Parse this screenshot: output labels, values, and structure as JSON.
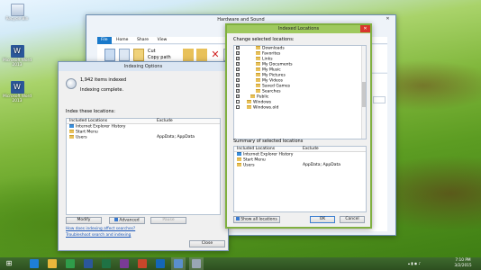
{
  "desktop_icons": [
    {
      "label": "Recycle Bin",
      "color": "#ccd8e8"
    },
    {
      "label": "Microsoft Word 2013",
      "color": "#2b579a"
    },
    {
      "label": "Microsoft Word 2013",
      "color": "#2b579a"
    }
  ],
  "hs_window": {
    "title": "Hardware and Sound",
    "ribbon": [
      "File",
      "Home",
      "Share",
      "View"
    ],
    "cut": "Cut",
    "copy_path": "Copy path"
  },
  "indexing": {
    "title": "Indexing Options",
    "items_indexed": "1,942 items indexed",
    "status": "Indexing complete.",
    "index_label": "Index these locations:",
    "col_included": "Included Locations",
    "col_exclude": "Exclude",
    "rows": [
      {
        "name": "Internet Explorer History",
        "exclude": ""
      },
      {
        "name": "Start Menu",
        "exclude": ""
      },
      {
        "name": "Users",
        "exclude": "AppData; AppData"
      }
    ],
    "modify": "Modify",
    "advanced": "Advanced",
    "pause": "Pause",
    "link1": "How does indexing affect searches?",
    "link2": "Troubleshoot search and indexing",
    "close": "Close"
  },
  "indexed": {
    "title": "Indexed Locations",
    "change_label": "Change selected locations:",
    "tree": [
      {
        "label": "Downloads",
        "checked": true
      },
      {
        "label": "Favorites",
        "checked": true
      },
      {
        "label": "Links",
        "checked": true
      },
      {
        "label": "My Documents",
        "checked": true
      },
      {
        "label": "My Music",
        "checked": true
      },
      {
        "label": "My Pictures",
        "checked": true
      },
      {
        "label": "My Videos",
        "checked": true
      },
      {
        "label": "Saved Games",
        "checked": true
      },
      {
        "label": "Searches",
        "checked": true
      },
      {
        "label": "Public",
        "checked": true
      },
      {
        "label": "Windows",
        "checked": false
      },
      {
        "label": "Windows.old",
        "checked": false
      }
    ],
    "summary_label": "Summary of selected locations",
    "col_included": "Included Locations",
    "col_exclude": "Exclude",
    "rows": [
      {
        "name": "Internet Explorer History",
        "exclude": ""
      },
      {
        "name": "Start Menu",
        "exclude": ""
      },
      {
        "name": "Users",
        "exclude": "AppData; AppData"
      }
    ],
    "show_all": "Show all locations",
    "ok": "OK",
    "cancel": "Cancel"
  },
  "taskbar": {
    "apps": [
      {
        "name": "ie-icon",
        "color": "#1e7fd6"
      },
      {
        "name": "explorer-icon",
        "color": "#e9b73b"
      },
      {
        "name": "store-icon",
        "color": "#2f9c4a"
      },
      {
        "name": "word-icon",
        "color": "#2b579a"
      },
      {
        "name": "excel-icon",
        "color": "#1f7244"
      },
      {
        "name": "onenote-icon",
        "color": "#7a3b96"
      },
      {
        "name": "powerpoint-icon",
        "color": "#c8462a"
      },
      {
        "name": "outlook-icon",
        "color": "#1466b8"
      },
      {
        "name": "control-panel-icon",
        "color": "#5a8fcc"
      },
      {
        "name": "indexing-icon",
        "color": "#9aa6b6"
      }
    ],
    "time": "7:10 PM",
    "date": "3/2/2015"
  }
}
